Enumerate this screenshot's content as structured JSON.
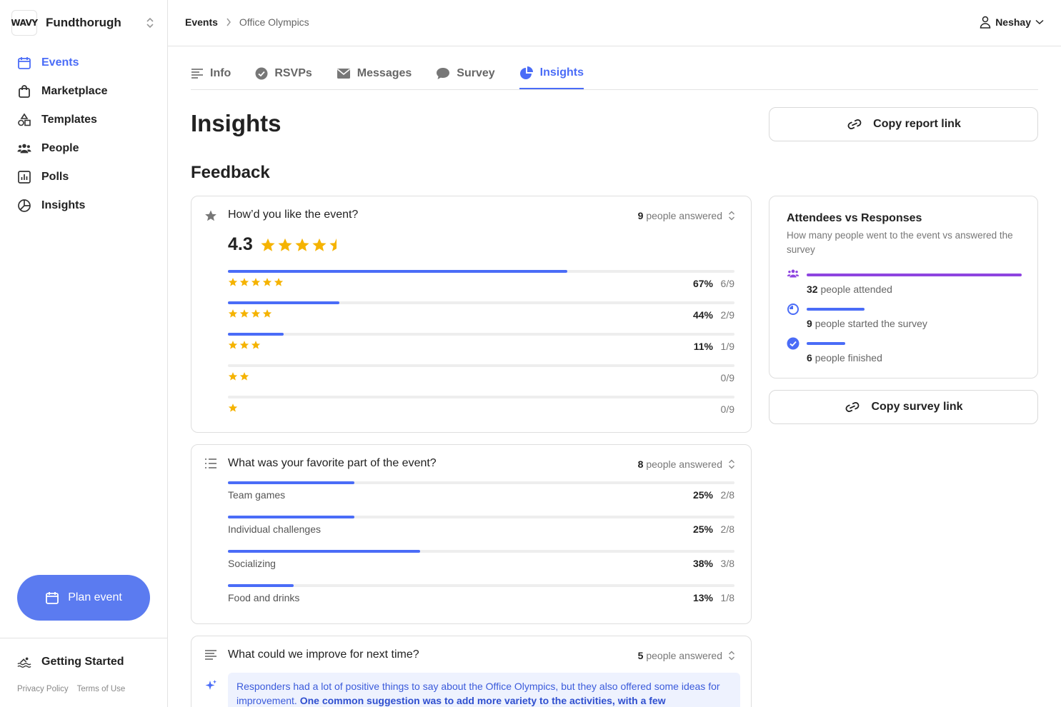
{
  "org": {
    "logo_text": "WAVY",
    "name": "Fundthorugh"
  },
  "nav": [
    {
      "label": "Events",
      "active": true
    },
    {
      "label": "Marketplace"
    },
    {
      "label": "Templates"
    },
    {
      "label": "People"
    },
    {
      "label": "Polls"
    },
    {
      "label": "Insights"
    }
  ],
  "plan_button": "Plan event",
  "getting_started": "Getting Started",
  "legal": {
    "privacy": "Privacy Policy",
    "terms": "Terms of Use"
  },
  "breadcrumb": {
    "root": "Events",
    "current": "Office Olympics"
  },
  "user": {
    "name": "Neshay"
  },
  "tabs": [
    {
      "label": "Info"
    },
    {
      "label": "RSVPs"
    },
    {
      "label": "Messages"
    },
    {
      "label": "Survey"
    },
    {
      "label": "Insights",
      "active": true
    }
  ],
  "page_title": "Insights",
  "section_title": "Feedback",
  "copy_report": "Copy report link",
  "copy_survey": "Copy survey link",
  "questions": [
    {
      "text": "How’d you like the event?",
      "answered_count": "9",
      "answered_label": "people answered",
      "average": "4.3",
      "rows": [
        {
          "stars": 5,
          "fraction": 0.67,
          "pct": "67%",
          "frac": "6/9"
        },
        {
          "stars": 4,
          "fraction": 0.22,
          "pct": "44%",
          "frac": "2/9"
        },
        {
          "stars": 3,
          "fraction": 0.11,
          "pct": "11%",
          "frac": "1/9"
        },
        {
          "stars": 2,
          "fraction": 0,
          "pct": "",
          "frac": "0/9"
        },
        {
          "stars": 1,
          "fraction": 0,
          "pct": "",
          "frac": "0/9"
        }
      ]
    },
    {
      "text": "What was your favorite part of the event?",
      "answered_count": "8",
      "answered_label": "people answered",
      "rows": [
        {
          "label": "Team games",
          "fraction": 0.25,
          "pct": "25%",
          "frac": "2/8"
        },
        {
          "label": "Individual challenges",
          "fraction": 0.25,
          "pct": "25%",
          "frac": "2/8"
        },
        {
          "label": "Socializing",
          "fraction": 0.38,
          "pct": "38%",
          "frac": "3/8"
        },
        {
          "label": "Food and drinks",
          "fraction": 0.13,
          "pct": "13%",
          "frac": "1/8"
        }
      ]
    },
    {
      "text": "What could we improve for next time?",
      "answered_count": "5",
      "answered_label": "people answered",
      "summary_plain": "Responders had a lot of positive things to say about the Office Olympics, but they also offered some ideas for improvement. ",
      "summary_bold": "One common suggestion was to add more variety to the activities, with a few"
    }
  ],
  "attendees": {
    "title": "Attendees vs Responses",
    "subtitle": "How many people went to the event vs answered the survey",
    "rows": [
      {
        "count": "32",
        "label": "people attended",
        "fraction": 1.0,
        "color": "#8e44e0"
      },
      {
        "count": "9",
        "label": "people started the survey",
        "fraction": 0.27,
        "color": "#4a6cf7"
      },
      {
        "count": "6",
        "label": "people finished",
        "fraction": 0.18,
        "color": "#4a6cf7"
      }
    ]
  },
  "colors": {
    "accent": "#4a6cf7",
    "star": "#f5b301",
    "purple": "#8e44e0"
  }
}
